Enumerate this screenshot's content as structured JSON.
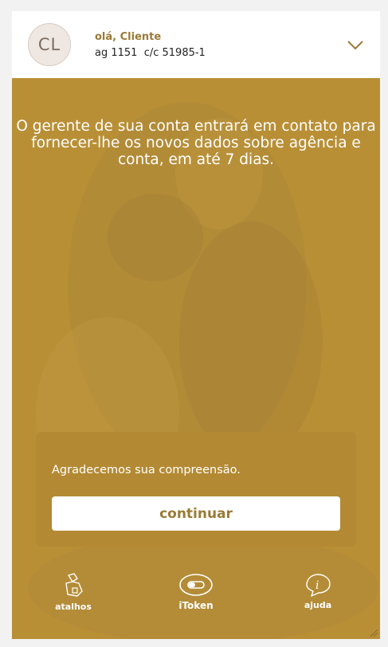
{
  "header": {
    "avatar_initials": "CL",
    "greeting": "olá, Cliente",
    "account_info": "ag 1151  c/c 51985-1"
  },
  "main": {
    "message": "O gerente de sua conta entrará em contato para fornecer-lhe os novos dados sobre agência e conta, em até 7 dias."
  },
  "card": {
    "text": "Agradecemos sua compreensão.",
    "continue_label": "continuar"
  },
  "tabs": [
    {
      "label": "atalhos",
      "icon": "shortcuts-icon"
    },
    {
      "label": "iToken",
      "icon": "itoken-icon"
    },
    {
      "label": "ajuda",
      "icon": "help-icon"
    }
  ],
  "colors": {
    "brand_gold": "#b98f36",
    "brand_text": "#9a7a35"
  }
}
